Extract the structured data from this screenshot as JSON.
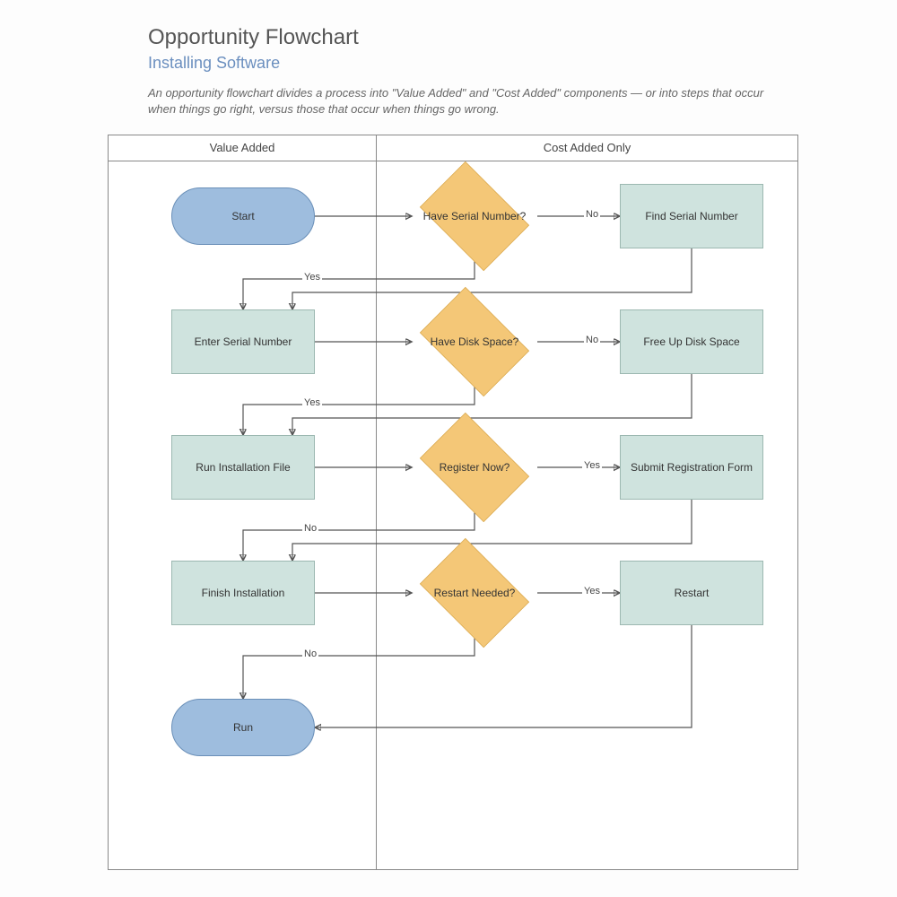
{
  "title": "Opportunity Flowchart",
  "subtitle": "Installing Software",
  "description": "An opportunity flowchart divides a process into \"Value Added\" and \"Cost Added\" components — or into steps that occur when things go right, versus those that occur when things go wrong.",
  "lanes": {
    "left": "Value Added",
    "right": "Cost Added Only"
  },
  "nodes": {
    "start": "Start",
    "have_serial": "Have Serial Number?",
    "find_serial": "Find Serial Number",
    "enter_serial": "Enter Serial Number",
    "have_disk": "Have Disk Space?",
    "free_disk": "Free Up Disk Space",
    "run_install": "Run Installation File",
    "register_now": "Register Now?",
    "submit_reg": "Submit Registration Form",
    "finish_install": "Finish Installation",
    "restart_needed": "Restart Needed?",
    "restart": "Restart",
    "run": "Run"
  },
  "edge_labels": {
    "yes": "Yes",
    "no": "No"
  },
  "edges": [
    {
      "from": "start",
      "to": "have_serial",
      "label": null
    },
    {
      "from": "have_serial",
      "to": "find_serial",
      "label": "No"
    },
    {
      "from": "have_serial",
      "to": "enter_serial",
      "label": "Yes"
    },
    {
      "from": "find_serial",
      "to": "enter_serial",
      "label": null
    },
    {
      "from": "enter_serial",
      "to": "have_disk",
      "label": null
    },
    {
      "from": "have_disk",
      "to": "free_disk",
      "label": "No"
    },
    {
      "from": "have_disk",
      "to": "run_install",
      "label": "Yes"
    },
    {
      "from": "free_disk",
      "to": "run_install",
      "label": null
    },
    {
      "from": "run_install",
      "to": "register_now",
      "label": null
    },
    {
      "from": "register_now",
      "to": "submit_reg",
      "label": "Yes"
    },
    {
      "from": "register_now",
      "to": "finish_install",
      "label": "No"
    },
    {
      "from": "submit_reg",
      "to": "finish_install",
      "label": null
    },
    {
      "from": "finish_install",
      "to": "restart_needed",
      "label": null
    },
    {
      "from": "restart_needed",
      "to": "restart",
      "label": "Yes"
    },
    {
      "from": "restart_needed",
      "to": "run",
      "label": "No"
    },
    {
      "from": "restart",
      "to": "run",
      "label": null
    }
  ]
}
